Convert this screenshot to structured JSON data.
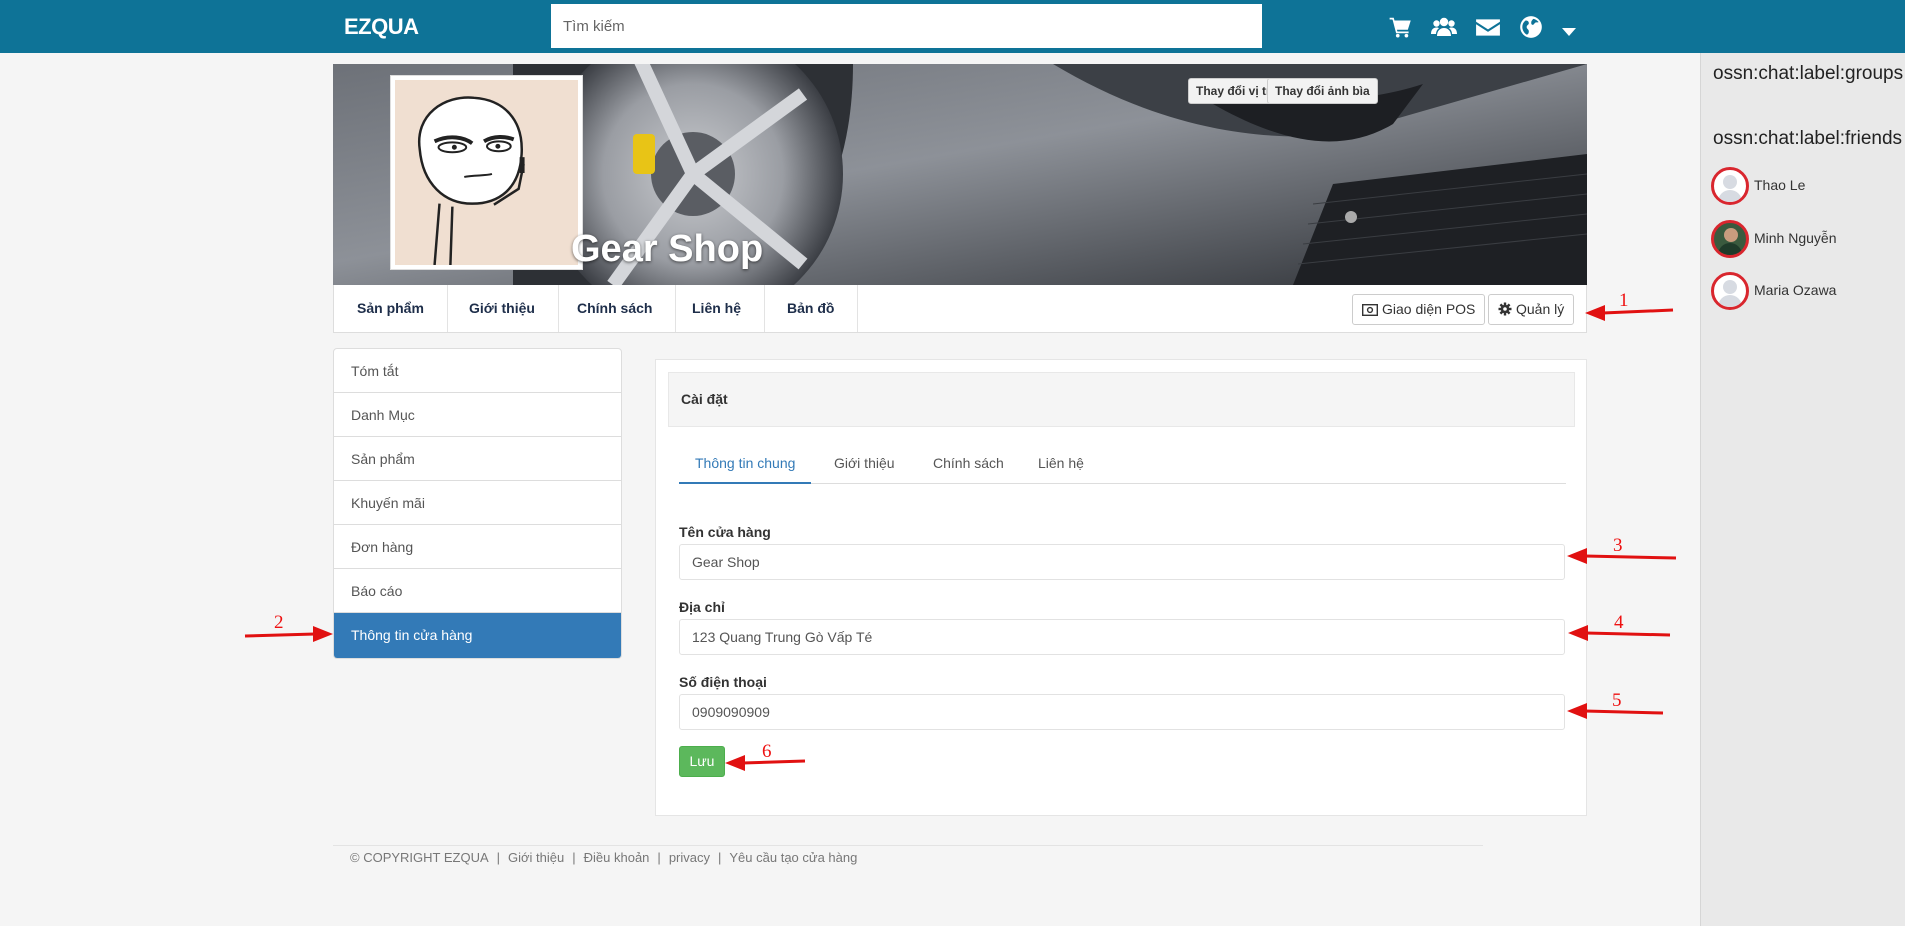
{
  "topbar": {
    "brand": "EZQUA",
    "search_placeholder": "Tìm kiếm",
    "icons": [
      "cart-icon",
      "users-icon",
      "envelope-icon",
      "globe-icon",
      "caret-down-icon"
    ],
    "background": "#0e7397"
  },
  "chat": {
    "groups_label": "ossn:chat:label:groups",
    "friends_label": "ossn:chat:label:friends",
    "friends": [
      {
        "name": "Thao Le"
      },
      {
        "name": "Minh Nguyễn"
      },
      {
        "name": "Maria Ozawa"
      }
    ]
  },
  "profile": {
    "shop_name": "Gear Shop",
    "change_position_label": "Thay đổi vị trí",
    "change_cover_label": "Thay đổi ảnh bìa"
  },
  "profile_nav": {
    "items": [
      "Sản phẩm",
      "Giới thiệu",
      "Chính sách",
      "Liên hệ",
      "Bản đồ"
    ],
    "pos_label": "Giao diện POS",
    "manage_label": "Quản lý"
  },
  "left_menu": {
    "items": [
      "Tóm tắt",
      "Danh Mục",
      "Sản phẩm",
      "Khuyến mãi",
      "Đơn hàng",
      "Báo cáo",
      "Thông tin cửa hàng"
    ],
    "active_index": 6
  },
  "settings": {
    "title": "Cài đặt",
    "tabs": [
      "Thông tin chung",
      "Giới thiệu",
      "Chính sách",
      "Liên hệ"
    ],
    "active_tab": 0,
    "fields": [
      {
        "label": "Tên cửa hàng",
        "value": "Gear Shop"
      },
      {
        "label": "Địa chỉ",
        "value": "123 Quang Trung Gò Vấp Té"
      },
      {
        "label": "Số điện thoại",
        "value": "0909090909"
      }
    ],
    "save_label": "Lưu",
    "save_color": "#5cb85c"
  },
  "footer": {
    "copyright": "© COPYRIGHT EZQUA",
    "links": [
      "Giới thiệu",
      "Điều khoản",
      "privacy",
      "Yêu cầu tạo cửa hàng"
    ]
  },
  "annotations": {
    "labels": [
      "1",
      "2",
      "3",
      "4",
      "5",
      "6"
    ],
    "color": "#e11111"
  }
}
